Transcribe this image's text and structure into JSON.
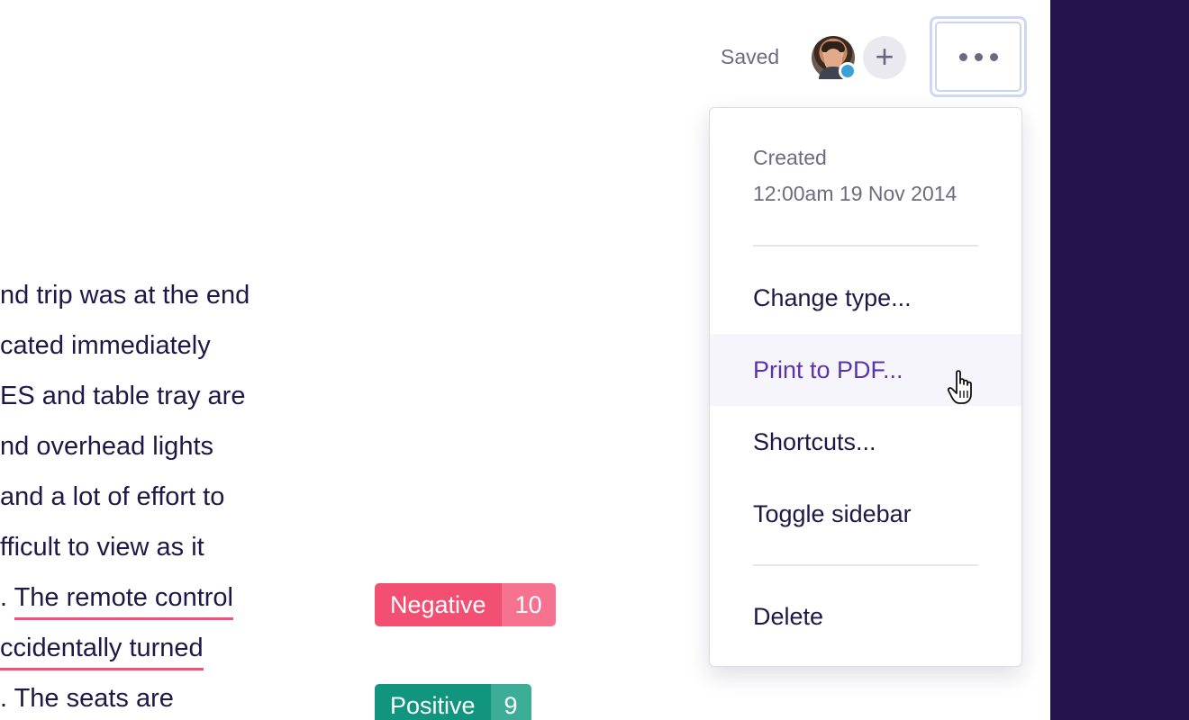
{
  "toolbar": {
    "saved_label": "Saved",
    "add_symbol": "+",
    "more_icon": "ellipsis-icon"
  },
  "document": {
    "lines": [
      "nd trip was at the end",
      "cated immediately",
      "ES and table tray are",
      "nd overhead lights",
      "and a lot of effort to",
      "fficult to view as it",
      ". The remote control",
      "ccidentally turned",
      ". The seats are"
    ]
  },
  "tags": [
    {
      "label": "Negative",
      "count": "10",
      "color": "#f24f73"
    },
    {
      "label": "Positive",
      "count": "9",
      "color": "#11957f"
    }
  ],
  "menu": {
    "created_label": "Created",
    "created_date": "12:00am 19 Nov 2014",
    "items": [
      "Change type...",
      "Print to PDF...",
      "Shortcuts...",
      "Toggle sidebar"
    ],
    "delete_label": "Delete"
  },
  "colors": {
    "sidebar_dark": "#24124d",
    "accent_purple": "#5a35a8",
    "underline_red": "#f0527a"
  }
}
